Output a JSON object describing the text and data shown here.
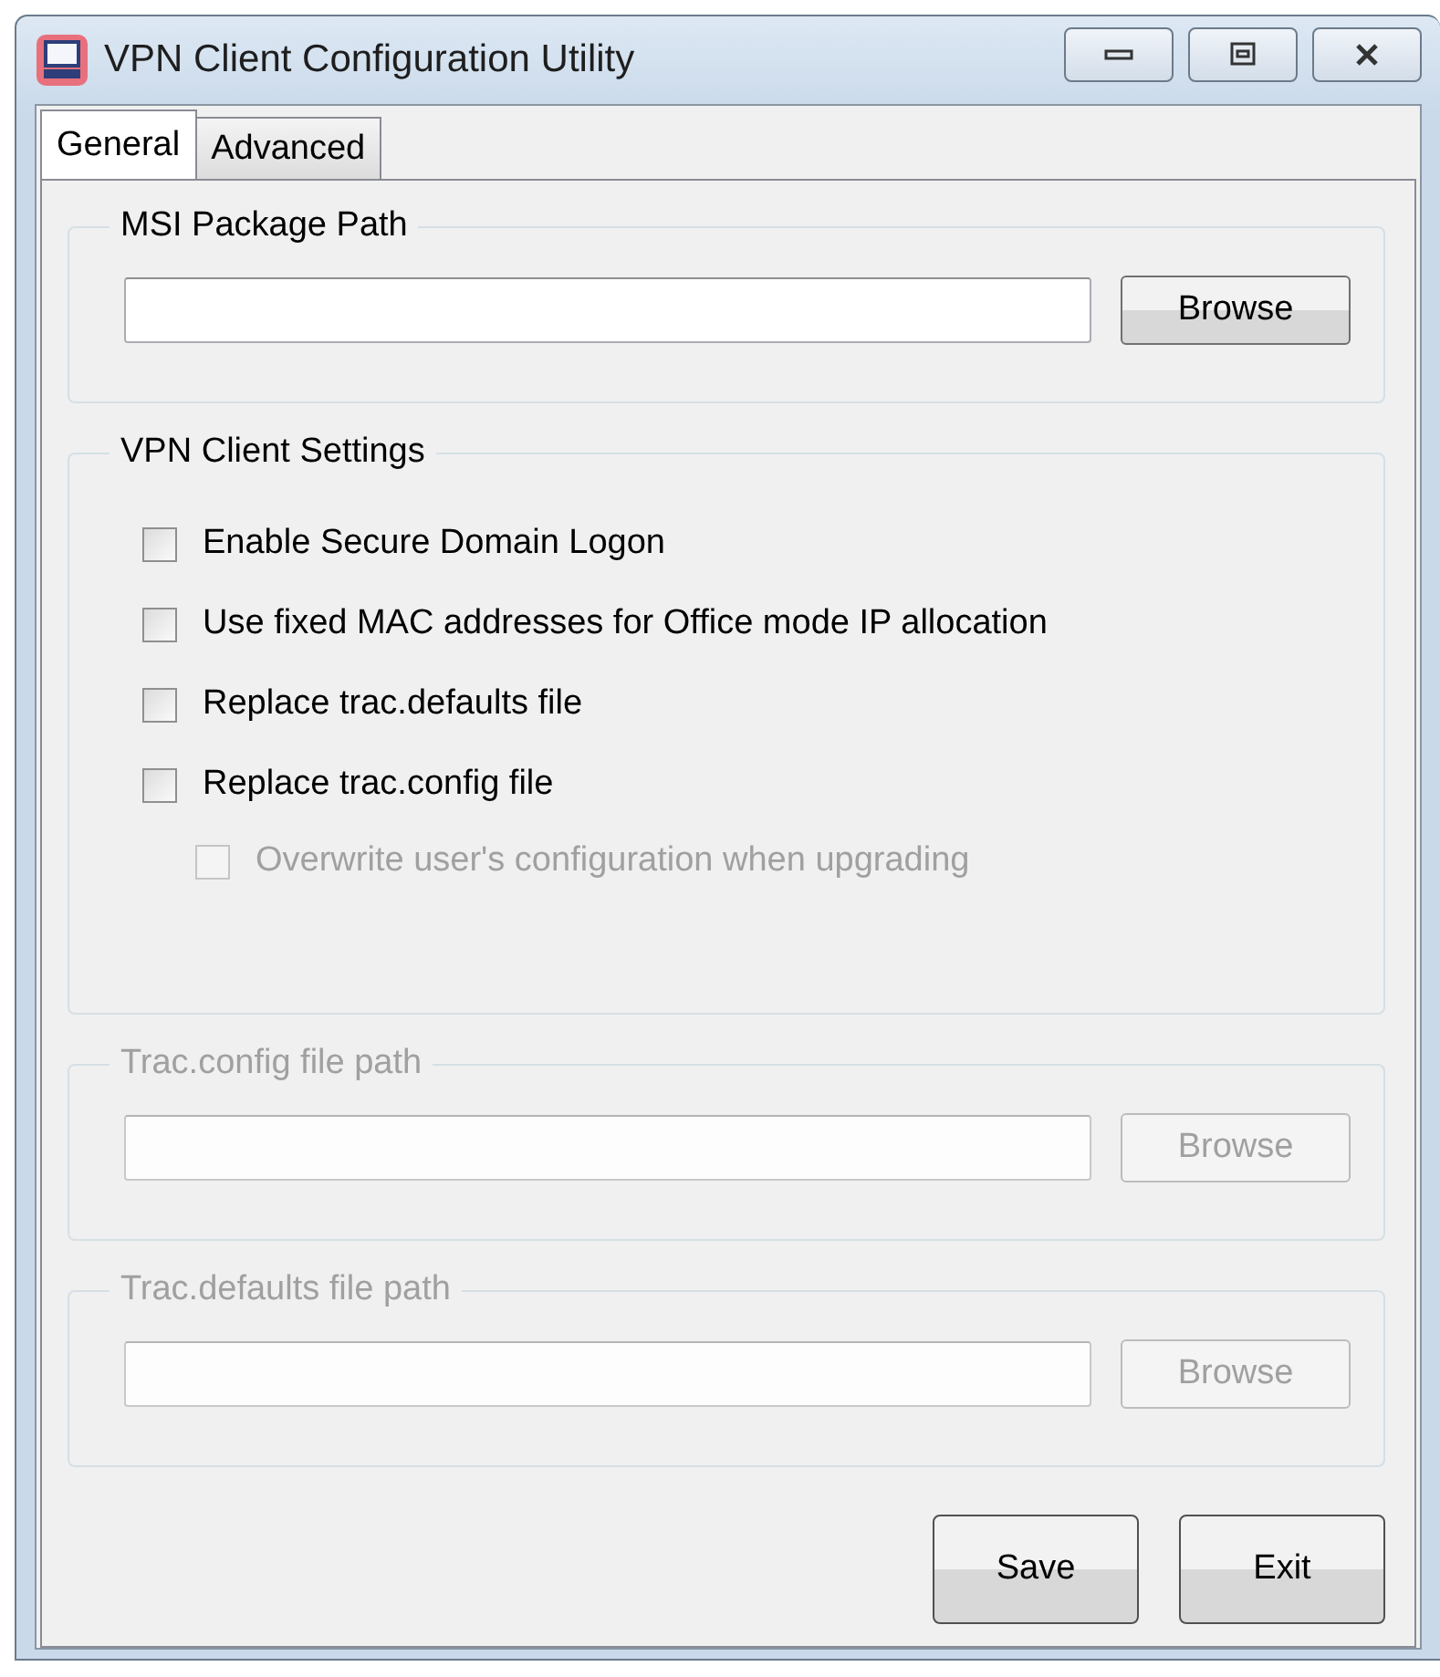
{
  "window": {
    "title": "VPN Client Configuration Utility"
  },
  "tabs": [
    {
      "label": "General",
      "selected": true
    },
    {
      "label": "Advanced",
      "selected": false
    }
  ],
  "groups": [
    {
      "title": "MSI Package Path",
      "disabled": false,
      "browse_button": "Browse"
    },
    {
      "title": "VPN Client Settings",
      "disabled": false,
      "options": [
        {
          "label": "Enable Secure Domain Logon",
          "checked": false,
          "disabled": false
        },
        {
          "label": "Use fixed MAC addresses for Office mode IP allocation",
          "checked": false,
          "disabled": false
        },
        {
          "label": "Replace trac.defaults file",
          "checked": false,
          "disabled": false
        },
        {
          "label": "Replace trac.config file",
          "checked": false,
          "disabled": false,
          "children": [
            {
              "label": "Overwrite user's configuration when upgrading",
              "checked": false,
              "disabled": true
            }
          ]
        }
      ]
    },
    {
      "title": "Trac.config file path",
      "disabled": true,
      "browse_button": "Browse"
    },
    {
      "title": "Trac.defaults file path",
      "disabled": true,
      "browse_button": "Browse"
    }
  ],
  "buttons": [
    "Save",
    "Exit"
  ]
}
